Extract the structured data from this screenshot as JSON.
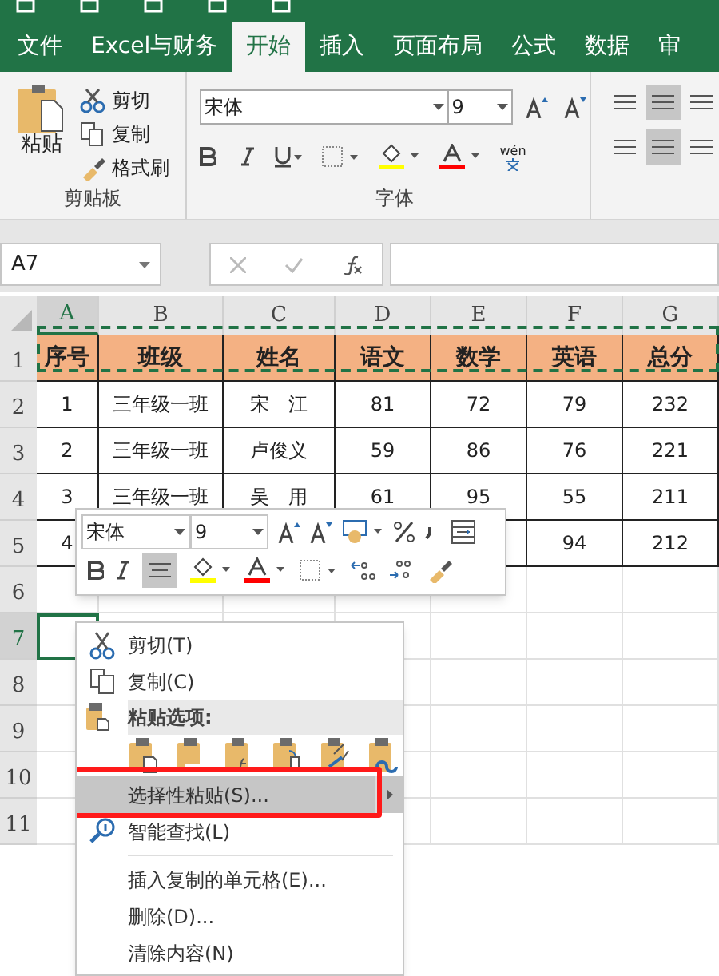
{
  "tabs": [
    {
      "label": "文件",
      "selected": false
    },
    {
      "label": "Excel与财务",
      "selected": false
    },
    {
      "label": "开始",
      "selected": true
    },
    {
      "label": "插入",
      "selected": false
    },
    {
      "label": "页面布局",
      "selected": false
    },
    {
      "label": "公式",
      "selected": false
    },
    {
      "label": "数据",
      "selected": false
    },
    {
      "label": "审",
      "selected": false
    }
  ],
  "ribbon": {
    "clipboard": {
      "paste": "粘贴",
      "cut": "剪切",
      "copy": "复制",
      "format_painter": "格式刷",
      "group": "剪贴板"
    },
    "font": {
      "font_name": "宋体",
      "font_size": "9",
      "phonetic": "wén",
      "group": "字体"
    }
  },
  "formula_bar": {
    "name_box": "A7"
  },
  "sheet": {
    "columns": [
      {
        "label": "A",
        "selected": true
      },
      {
        "label": "B",
        "selected": false
      },
      {
        "label": "C",
        "selected": false
      },
      {
        "label": "D",
        "selected": false
      },
      {
        "label": "E",
        "selected": false
      },
      {
        "label": "F",
        "selected": false
      },
      {
        "label": "G",
        "selected": false
      }
    ],
    "rows": [
      {
        "number": "1",
        "kind": "header",
        "selected": false,
        "cells": [
          "序号",
          "班级",
          "姓名",
          "语文",
          "数学",
          "英语",
          "总分"
        ]
      },
      {
        "number": "2",
        "kind": "data",
        "selected": false,
        "cells": [
          "1",
          "三年级一班",
          "宋　江",
          "81",
          "72",
          "79",
          "232"
        ]
      },
      {
        "number": "3",
        "kind": "data",
        "selected": false,
        "cells": [
          "2",
          "三年级一班",
          "卢俊义",
          "59",
          "86",
          "76",
          "221"
        ]
      },
      {
        "number": "4",
        "kind": "data",
        "selected": false,
        "cells": [
          "3",
          "三年级一班",
          "吴　用",
          "61",
          "95",
          "55",
          "211"
        ]
      },
      {
        "number": "5",
        "kind": "data",
        "selected": false,
        "cells": [
          "4",
          null,
          null,
          null,
          null,
          "94",
          "212"
        ]
      },
      {
        "number": "6",
        "kind": "empty",
        "selected": false
      },
      {
        "number": "7",
        "kind": "empty",
        "selected": true
      },
      {
        "number": "8",
        "kind": "empty",
        "selected": false
      },
      {
        "number": "9",
        "kind": "empty",
        "selected": false
      },
      {
        "number": "10",
        "kind": "empty",
        "selected": false
      },
      {
        "number": "11",
        "kind": "empty",
        "selected": false
      }
    ]
  },
  "mini_toolbar": {
    "font_name": "宋体",
    "font_size": "9"
  },
  "context_menu": [
    {
      "kind": "item",
      "label": "剪切(T)",
      "selected": false
    },
    {
      "kind": "item",
      "label": "复制(C)",
      "selected": false
    },
    {
      "kind": "header",
      "label": "粘贴选项:"
    },
    {
      "kind": "paste_icons"
    },
    {
      "kind": "item",
      "label": "选择性粘贴(S)...",
      "selected": true,
      "submenu": true,
      "highlighted_box": true
    },
    {
      "kind": "item",
      "label": "智能查找(L)",
      "selected": false
    },
    {
      "kind": "separator"
    },
    {
      "kind": "item",
      "label": "插入复制的单元格(E)...",
      "selected": false
    },
    {
      "kind": "item",
      "label": "删除(D)...",
      "selected": false
    },
    {
      "kind": "item",
      "label": "清除内容(N)",
      "selected": false
    }
  ]
}
